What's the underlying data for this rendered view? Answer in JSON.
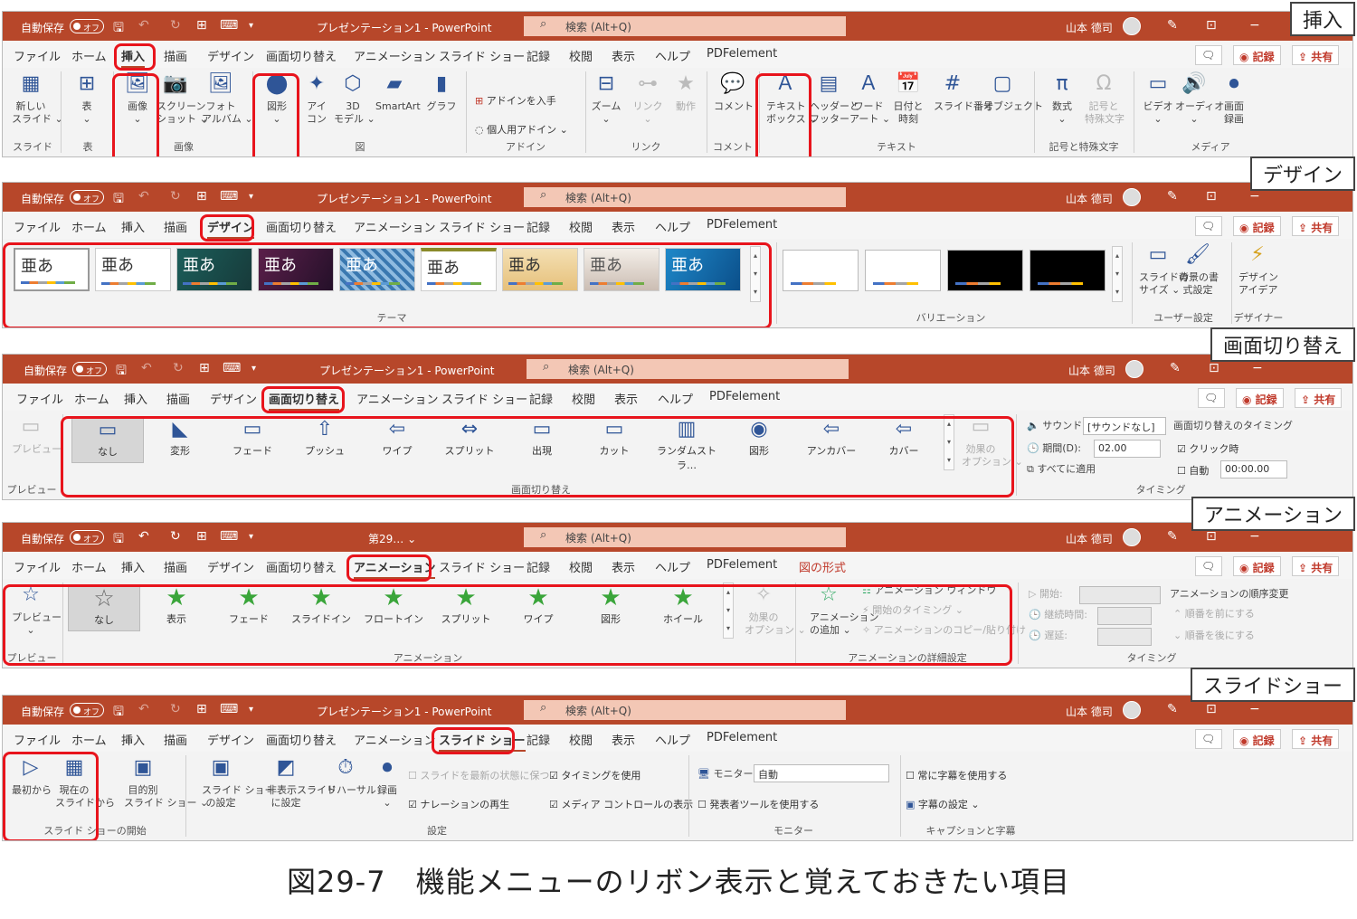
{
  "title_bar": {
    "autosave": "自動保存",
    "toggle": "オフ",
    "doc_title": "プレゼンテーション1 - PowerPoint",
    "doc_title_short": "第29… ⌄",
    "search": "検索 (Alt+Q)",
    "user": "山本 德司"
  },
  "tabs": [
    "ファイル",
    "ホーム",
    "挿入",
    "描画",
    "デザイン",
    "画面切り替え",
    "アニメーション",
    "スライド ショー",
    "記録",
    "校閲",
    "表示",
    "ヘルプ",
    "PDFelement"
  ],
  "context_tab": "図の形式",
  "buttons": {
    "record": "記録",
    "share": "共有"
  },
  "callouts": [
    "挿入",
    "デザイン",
    "画面切り替え",
    "アニメーション",
    "スライドショー"
  ],
  "insert": {
    "items": [
      "新しい\nスライド ⌄",
      "表\n⌄",
      "画像\n⌄",
      "スクリーン\nショット ⌄",
      "フォト\nアルバム ⌄",
      "図形\n⌄",
      "アイ\nコン",
      "3D\nモデル ⌄",
      "SmartArt",
      "グラフ",
      "ズーム\n⌄",
      "リンク\n⌄",
      "動作",
      "コメント",
      "テキスト\nボックス ⌄",
      "ヘッダーと\nフッター",
      "ワード\nアート ⌄",
      "日付と\n時刻",
      "スライド番号",
      "オブジェクト",
      "数式\n⌄",
      "記号と\n特殊文字",
      "ビデオ\n⌄",
      "オーディオ\n⌄",
      "画面\n録画"
    ],
    "addins": [
      "アドインを入手",
      "個人用アドイン ⌄"
    ],
    "groups": [
      "スライド",
      "表",
      "画像",
      "図",
      "アドイン",
      "リンク",
      "コメント",
      "テキスト",
      "記号と特殊文字",
      "メディア"
    ]
  },
  "design": {
    "theme_text": "亜あ",
    "custom": [
      "スライドの\nサイズ ⌄",
      "背景の書\n式設定"
    ],
    "designer": "デザイン\nアイデア",
    "groups": [
      "テーマ",
      "バリエーション",
      "ユーザー設定",
      "デザイナー"
    ]
  },
  "transitions": {
    "preview": "プレビュー",
    "items": [
      "なし",
      "変形",
      "フェード",
      "プッシュ",
      "ワイプ",
      "スプリット",
      "出現",
      "カット",
      "ランダムストラ…",
      "図形",
      "アンカバー",
      "カバー"
    ],
    "effect": "効果の\nオプション ⌄",
    "sound_label": "サウンド:",
    "sound": "[サウンドなし]",
    "duration_label": "期間(D):",
    "duration": "02.00",
    "apply_all": "すべてに適用",
    "timing_head": "画面切り替えのタイミング",
    "on_click": "クリック時",
    "auto": "自動",
    "auto_time": "00:00.00",
    "groups": [
      "プレビュー",
      "画面切り替え",
      "タイミング"
    ]
  },
  "animation": {
    "preview": "プレビュー\n⌄",
    "items": [
      "なし",
      "表示",
      "フェード",
      "スライドイン",
      "フロートイン",
      "スプリット",
      "ワイプ",
      "図形",
      "ホイール"
    ],
    "effect": "効果の\nオプション ⌄",
    "add": "アニメーション\nの追加 ⌄",
    "pane": "アニメーション ウィンドウ",
    "trigger": "開始のタイミング ⌄",
    "painter": "アニメーションのコピー/貼り付け",
    "start": "開始:",
    "duration": "継続時間:",
    "delay": "遅延:",
    "reorder": "アニメーションの順序変更",
    "earlier": "順番を前にする",
    "later": "順番を後にする",
    "groups": [
      "プレビュー",
      "アニメーション",
      "アニメーションの詳細設定",
      "タイミング"
    ]
  },
  "slideshow": {
    "items": [
      "最初から",
      "現在の\nスライドから",
      "目的別\nスライド ショー ⌄",
      "スライド ショー\nの設定",
      "非表示スライド\nに設定",
      "リハーサル",
      "録画\n⌄"
    ],
    "keep_fresh": "スライドを最新の状態に保つ",
    "use_timing": "タイミングを使用",
    "narration": "ナレーションの再生",
    "media": "メディア コントロールの表示",
    "monitor_label": "モニター:",
    "monitor": "自動",
    "presenter": "発表者ツールを使用する",
    "subtitles": "常に字幕を使用する",
    "subtitle_settings": "字幕の設定 ⌄",
    "groups": [
      "スライド ショーの開始",
      "設定",
      "モニター",
      "キャプションと字幕"
    ]
  },
  "caption": "図29-7　機能メニューのリボン表示と覚えておきたい項目"
}
